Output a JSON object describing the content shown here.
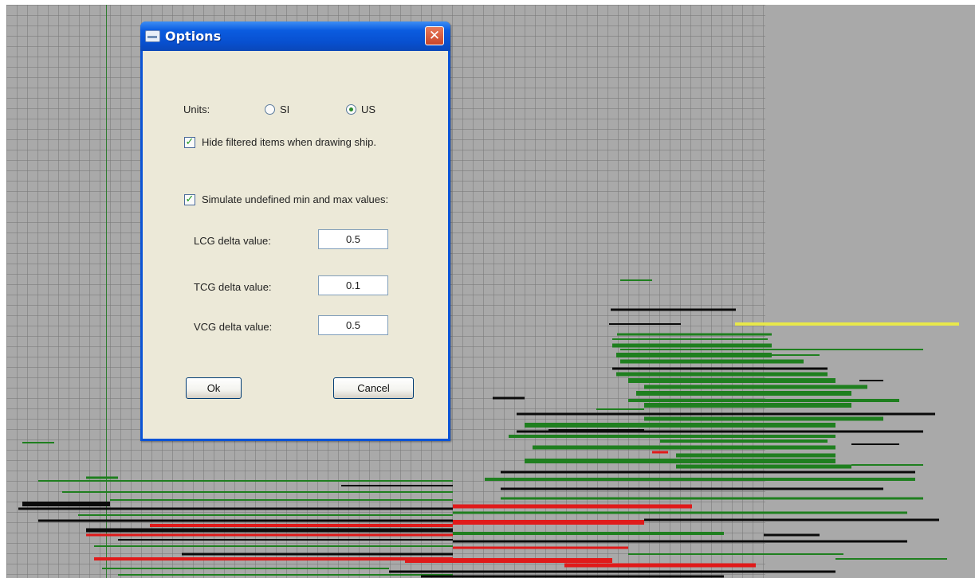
{
  "dialog": {
    "title": "Options",
    "title_icon": "app-icon",
    "close_icon": "close-icon",
    "close_glyph": "✕",
    "units_label": "Units:",
    "units_options": [
      {
        "label": "SI",
        "selected": false
      },
      {
        "label": "US",
        "selected": true
      }
    ],
    "hide_filtered": {
      "label": "Hide filtered items when drawing ship.",
      "checked": true
    },
    "simulate": {
      "label": "Simulate undefined min and max values:",
      "checked": true
    },
    "check_glyph": "✓",
    "fields": [
      {
        "label": "LCG delta value:",
        "value": "0.5"
      },
      {
        "label": "TCG delta value:",
        "value": "0.1"
      },
      {
        "label": "VCG delta value:",
        "value": "0.5"
      }
    ],
    "ok_label": "Ok",
    "cancel_label": "Cancel"
  },
  "colors": {
    "grid_background": "#a9a9a9",
    "green_bars": "#1f7f1f",
    "black_bars": "#0a0a0a",
    "red_bars": "#e01a1a",
    "yellow_line": "#e8e84a",
    "dialog_titlebar": "#0a53d6",
    "dialog_body": "#ece9d8"
  }
}
